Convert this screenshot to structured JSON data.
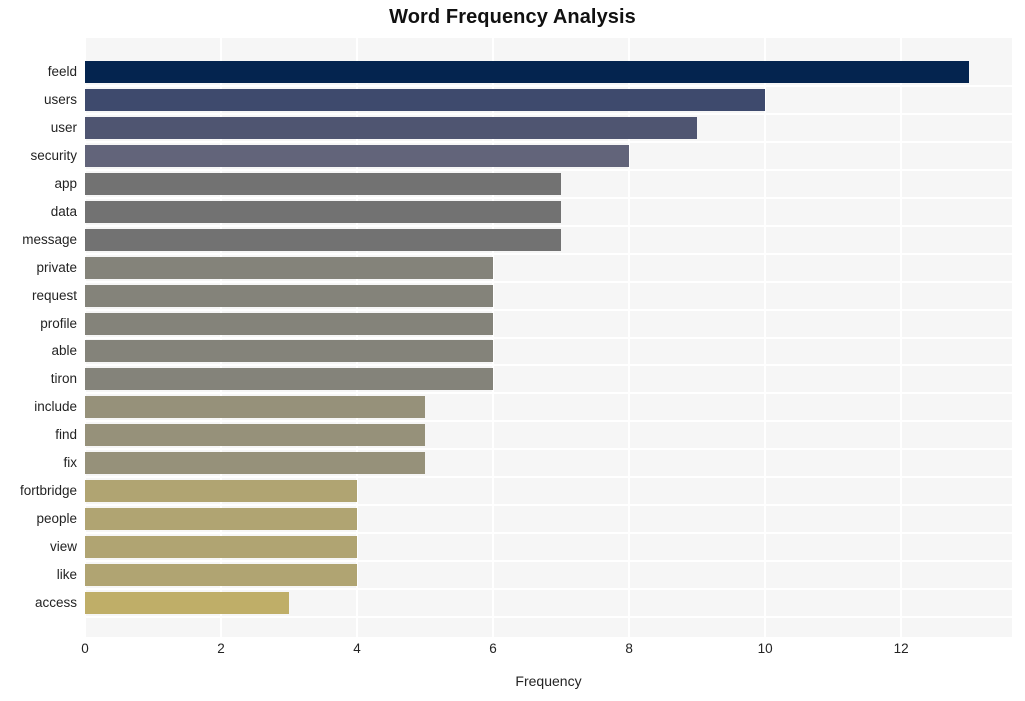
{
  "chart_data": {
    "type": "bar",
    "orientation": "horizontal",
    "title": "Word Frequency Analysis",
    "xlabel": "Frequency",
    "ylabel": "",
    "categories": [
      "feeld",
      "users",
      "user",
      "security",
      "app",
      "data",
      "message",
      "private",
      "request",
      "profile",
      "able",
      "tiron",
      "include",
      "find",
      "fix",
      "fortbridge",
      "people",
      "view",
      "like",
      "access"
    ],
    "values": [
      13,
      10,
      9,
      8,
      7,
      7,
      7,
      6,
      6,
      6,
      6,
      6,
      5,
      5,
      5,
      4,
      4,
      4,
      4,
      3
    ],
    "bar_colors": [
      "#04244f",
      "#3e4a6d",
      "#4f5571",
      "#62647a",
      "#727272",
      "#727272",
      "#727272",
      "#84837a",
      "#84837a",
      "#84837a",
      "#84837a",
      "#84837a",
      "#96917a",
      "#96917a",
      "#96917a",
      "#b0a472",
      "#b0a472",
      "#b0a472",
      "#b0a472",
      "#bfae68"
    ],
    "xlim": [
      0,
      13.63
    ],
    "xticks": [
      0,
      2,
      4,
      6,
      8,
      10,
      12
    ],
    "xticklabels": [
      "0",
      "2",
      "4",
      "6",
      "8",
      "10",
      "12"
    ],
    "grid": true,
    "legend": false,
    "plot_background": "#f6f6f6",
    "gridline_color": "#ffffff",
    "figure_background": "#ffffff"
  }
}
